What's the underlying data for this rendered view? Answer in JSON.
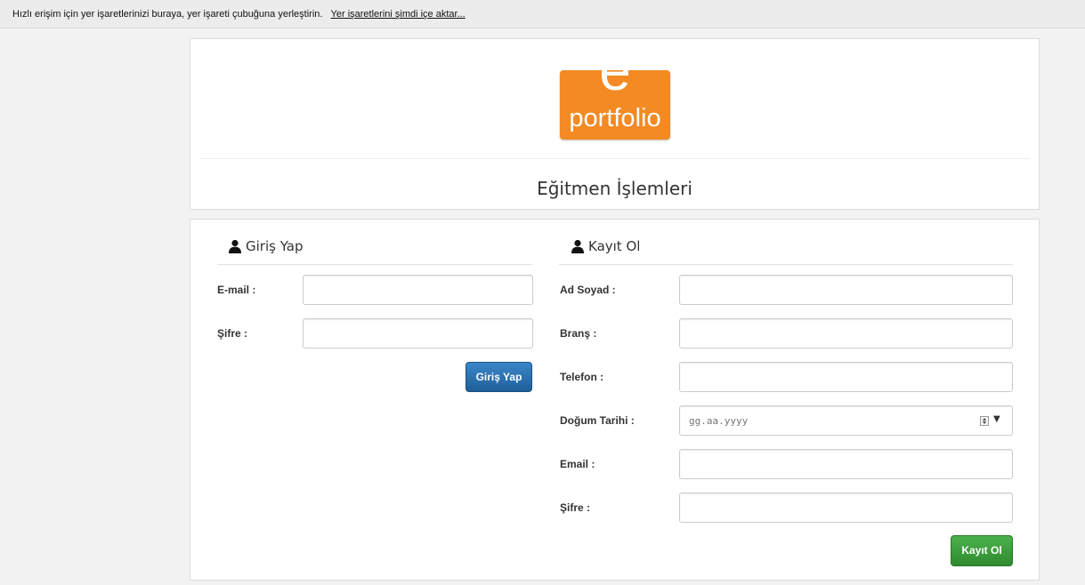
{
  "bookmarks_bar": {
    "message": "Hızlı erişim için yer işaretlerinizi buraya, yer işareti çubuğuna yerleştirin.",
    "import_link": "Yer işaretlerini şimdi içe aktar..."
  },
  "logo": {
    "letter": "e",
    "word": "portfolio"
  },
  "page_title": "Eğitmen İşlemleri",
  "login": {
    "title": "Giriş Yap",
    "email_label": "E-mail :",
    "email_value": "",
    "password_label": "Şifre :",
    "password_value": "",
    "submit_label": "Giriş Yap"
  },
  "register": {
    "title": "Kayıt Ol",
    "name_label": "Ad Soyad :",
    "name_value": "",
    "branch_label": "Branş :",
    "branch_value": "",
    "phone_label": "Telefon :",
    "phone_value": "",
    "birthdate_label": "Doğum Tarihi :",
    "birthdate_placeholder": "gg.aa.yyyy",
    "email_label": "Email :",
    "email_value": "",
    "password_label": "Şifre :",
    "password_value": "",
    "submit_label": "Kayıt Ol"
  },
  "colors": {
    "brand_orange": "#f38a23",
    "primary_button": "#2a6fad",
    "success_button": "#3d9e3d"
  }
}
